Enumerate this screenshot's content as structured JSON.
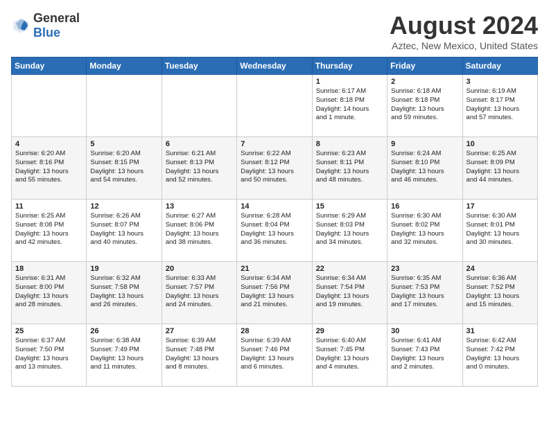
{
  "header": {
    "logo_general": "General",
    "logo_blue": "Blue",
    "month_year": "August 2024",
    "location": "Aztec, New Mexico, United States"
  },
  "days_of_week": [
    "Sunday",
    "Monday",
    "Tuesday",
    "Wednesday",
    "Thursday",
    "Friday",
    "Saturday"
  ],
  "weeks": [
    [
      {
        "day": "",
        "info": ""
      },
      {
        "day": "",
        "info": ""
      },
      {
        "day": "",
        "info": ""
      },
      {
        "day": "",
        "info": ""
      },
      {
        "day": "1",
        "info": "Sunrise: 6:17 AM\nSunset: 8:18 PM\nDaylight: 14 hours\nand 1 minute."
      },
      {
        "day": "2",
        "info": "Sunrise: 6:18 AM\nSunset: 8:18 PM\nDaylight: 13 hours\nand 59 minutes."
      },
      {
        "day": "3",
        "info": "Sunrise: 6:19 AM\nSunset: 8:17 PM\nDaylight: 13 hours\nand 57 minutes."
      }
    ],
    [
      {
        "day": "4",
        "info": "Sunrise: 6:20 AM\nSunset: 8:16 PM\nDaylight: 13 hours\nand 55 minutes."
      },
      {
        "day": "5",
        "info": "Sunrise: 6:20 AM\nSunset: 8:15 PM\nDaylight: 13 hours\nand 54 minutes."
      },
      {
        "day": "6",
        "info": "Sunrise: 6:21 AM\nSunset: 8:13 PM\nDaylight: 13 hours\nand 52 minutes."
      },
      {
        "day": "7",
        "info": "Sunrise: 6:22 AM\nSunset: 8:12 PM\nDaylight: 13 hours\nand 50 minutes."
      },
      {
        "day": "8",
        "info": "Sunrise: 6:23 AM\nSunset: 8:11 PM\nDaylight: 13 hours\nand 48 minutes."
      },
      {
        "day": "9",
        "info": "Sunrise: 6:24 AM\nSunset: 8:10 PM\nDaylight: 13 hours\nand 46 minutes."
      },
      {
        "day": "10",
        "info": "Sunrise: 6:25 AM\nSunset: 8:09 PM\nDaylight: 13 hours\nand 44 minutes."
      }
    ],
    [
      {
        "day": "11",
        "info": "Sunrise: 6:25 AM\nSunset: 8:08 PM\nDaylight: 13 hours\nand 42 minutes."
      },
      {
        "day": "12",
        "info": "Sunrise: 6:26 AM\nSunset: 8:07 PM\nDaylight: 13 hours\nand 40 minutes."
      },
      {
        "day": "13",
        "info": "Sunrise: 6:27 AM\nSunset: 8:06 PM\nDaylight: 13 hours\nand 38 minutes."
      },
      {
        "day": "14",
        "info": "Sunrise: 6:28 AM\nSunset: 8:04 PM\nDaylight: 13 hours\nand 36 minutes."
      },
      {
        "day": "15",
        "info": "Sunrise: 6:29 AM\nSunset: 8:03 PM\nDaylight: 13 hours\nand 34 minutes."
      },
      {
        "day": "16",
        "info": "Sunrise: 6:30 AM\nSunset: 8:02 PM\nDaylight: 13 hours\nand 32 minutes."
      },
      {
        "day": "17",
        "info": "Sunrise: 6:30 AM\nSunset: 8:01 PM\nDaylight: 13 hours\nand 30 minutes."
      }
    ],
    [
      {
        "day": "18",
        "info": "Sunrise: 6:31 AM\nSunset: 8:00 PM\nDaylight: 13 hours\nand 28 minutes."
      },
      {
        "day": "19",
        "info": "Sunrise: 6:32 AM\nSunset: 7:58 PM\nDaylight: 13 hours\nand 26 minutes."
      },
      {
        "day": "20",
        "info": "Sunrise: 6:33 AM\nSunset: 7:57 PM\nDaylight: 13 hours\nand 24 minutes."
      },
      {
        "day": "21",
        "info": "Sunrise: 6:34 AM\nSunset: 7:56 PM\nDaylight: 13 hours\nand 21 minutes."
      },
      {
        "day": "22",
        "info": "Sunrise: 6:34 AM\nSunset: 7:54 PM\nDaylight: 13 hours\nand 19 minutes."
      },
      {
        "day": "23",
        "info": "Sunrise: 6:35 AM\nSunset: 7:53 PM\nDaylight: 13 hours\nand 17 minutes."
      },
      {
        "day": "24",
        "info": "Sunrise: 6:36 AM\nSunset: 7:52 PM\nDaylight: 13 hours\nand 15 minutes."
      }
    ],
    [
      {
        "day": "25",
        "info": "Sunrise: 6:37 AM\nSunset: 7:50 PM\nDaylight: 13 hours\nand 13 minutes."
      },
      {
        "day": "26",
        "info": "Sunrise: 6:38 AM\nSunset: 7:49 PM\nDaylight: 13 hours\nand 11 minutes."
      },
      {
        "day": "27",
        "info": "Sunrise: 6:39 AM\nSunset: 7:48 PM\nDaylight: 13 hours\nand 8 minutes."
      },
      {
        "day": "28",
        "info": "Sunrise: 6:39 AM\nSunset: 7:46 PM\nDaylight: 13 hours\nand 6 minutes."
      },
      {
        "day": "29",
        "info": "Sunrise: 6:40 AM\nSunset: 7:45 PM\nDaylight: 13 hours\nand 4 minutes."
      },
      {
        "day": "30",
        "info": "Sunrise: 6:41 AM\nSunset: 7:43 PM\nDaylight: 13 hours\nand 2 minutes."
      },
      {
        "day": "31",
        "info": "Sunrise: 6:42 AM\nSunset: 7:42 PM\nDaylight: 13 hours\nand 0 minutes."
      }
    ]
  ]
}
